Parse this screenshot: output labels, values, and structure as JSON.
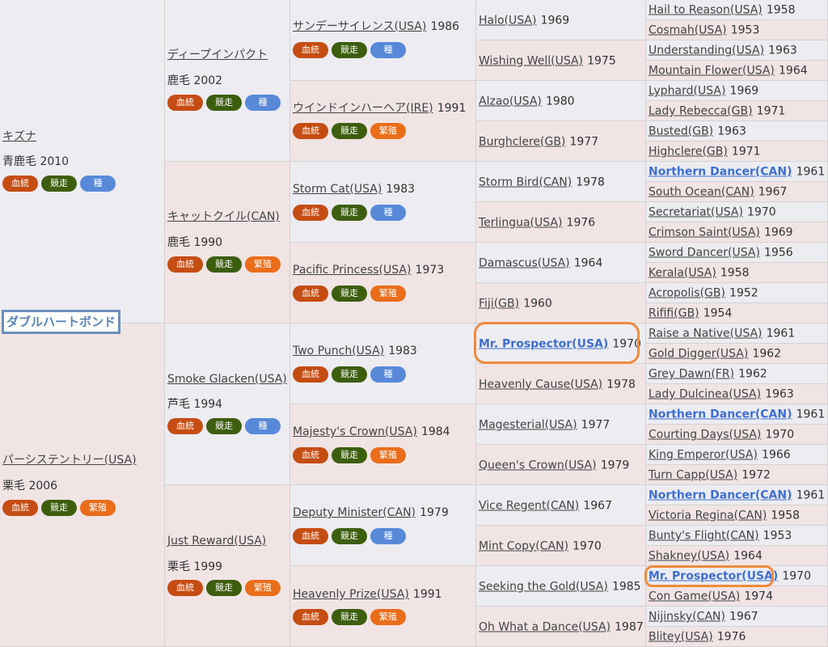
{
  "badges": {
    "ketto": "血統",
    "kyoso": "競走",
    "shu": "種",
    "hanshoku": "繁殖"
  },
  "focus_horse": "ダブルハートボンド",
  "gen1": [
    {
      "name": "キズナ",
      "coat": "青鹿毛 2010",
      "badge3": "種"
    },
    {
      "name": "パーシステントリー(USA)",
      "coat": "栗毛 2006",
      "badge3": "繁殖"
    }
  ],
  "gen2": [
    {
      "name": "ディープインパクト",
      "coat": "鹿毛 2002",
      "badge3": "種"
    },
    {
      "name": "キャットクイル(CAN)",
      "coat": "鹿毛 1990",
      "badge3": "繁殖"
    },
    {
      "name": "Smoke Glacken(USA)",
      "coat": "芦毛 1994",
      "badge3": "種"
    },
    {
      "name": "Just Reward(USA)",
      "coat": "栗毛 1999",
      "badge3": "繁殖"
    }
  ],
  "gen3": [
    {
      "name": "サンデーサイレンス(USA)",
      "year": "1986",
      "badge3": "種"
    },
    {
      "name": "ウインドインハーヘア(IRE)",
      "year": "1991",
      "badge3": "繁殖"
    },
    {
      "name": "Storm Cat(USA)",
      "year": "1983",
      "badge3": "種"
    },
    {
      "name": "Pacific Princess(USA)",
      "year": "1973",
      "badge3": "繁殖"
    },
    {
      "name": "Two Punch(USA)",
      "year": "1983",
      "badge3": "種"
    },
    {
      "name": "Majesty's Crown(USA)",
      "year": "1984",
      "badge3": "繁殖"
    },
    {
      "name": "Deputy Minister(CAN)",
      "year": "1979",
      "badge3": "種"
    },
    {
      "name": "Heavenly Prize(USA)",
      "year": "1991",
      "badge3": "繁殖"
    }
  ],
  "gen4": [
    {
      "name": "Halo(USA)",
      "year": "1969"
    },
    {
      "name": "Wishing Well(USA)",
      "year": "1975"
    },
    {
      "name": "Alzao(USA)",
      "year": "1980"
    },
    {
      "name": "Burghclere(GB)",
      "year": "1977"
    },
    {
      "name": "Storm Bird(CAN)",
      "year": "1978"
    },
    {
      "name": "Terlingua(USA)",
      "year": "1976"
    },
    {
      "name": "Damascus(USA)",
      "year": "1964"
    },
    {
      "name": "Fiji(GB)",
      "year": "1960"
    },
    {
      "name": "Mr. Prospector(USA)",
      "year": "1970"
    },
    {
      "name": "Heavenly Cause(USA)",
      "year": "1978"
    },
    {
      "name": "Magesterial(USA)",
      "year": "1977"
    },
    {
      "name": "Queen's Crown(USA)",
      "year": "1979"
    },
    {
      "name": "Vice Regent(CAN)",
      "year": "1967"
    },
    {
      "name": "Mint Copy(CAN)",
      "year": "1970"
    },
    {
      "name": "Seeking the Gold(USA)",
      "year": "1985"
    },
    {
      "name": "Oh What a Dance(USA)",
      "year": "1987"
    }
  ],
  "gen5": [
    {
      "name": "Hail to Reason(USA)",
      "year": "1958"
    },
    {
      "name": "Cosmah(USA)",
      "year": "1953"
    },
    {
      "name": "Understanding(USA)",
      "year": "1963"
    },
    {
      "name": "Mountain Flower(USA)",
      "year": "1964"
    },
    {
      "name": "Lyphard(USA)",
      "year": "1969"
    },
    {
      "name": "Lady Rebecca(GB)",
      "year": "1971"
    },
    {
      "name": "Busted(GB)",
      "year": "1963"
    },
    {
      "name": "Highclere(GB)",
      "year": "1971"
    },
    {
      "name": "Northern Dancer(CAN)",
      "year": "1961"
    },
    {
      "name": "South Ocean(CAN)",
      "year": "1967"
    },
    {
      "name": "Secretariat(USA)",
      "year": "1970"
    },
    {
      "name": "Crimson Saint(USA)",
      "year": "1969"
    },
    {
      "name": "Sword Dancer(USA)",
      "year": "1956"
    },
    {
      "name": "Kerala(USA)",
      "year": "1958"
    },
    {
      "name": "Acropolis(GB)",
      "year": "1952"
    },
    {
      "name": "Rififi(GB)",
      "year": "1954"
    },
    {
      "name": "Raise a Native(USA)",
      "year": "1961"
    },
    {
      "name": "Gold Digger(USA)",
      "year": "1962"
    },
    {
      "name": "Grey Dawn(FR)",
      "year": "1962"
    },
    {
      "name": "Lady Dulcinea(USA)",
      "year": "1963"
    },
    {
      "name": "Northern Dancer(CAN)",
      "year": "1961"
    },
    {
      "name": "Courting Days(USA)",
      "year": "1970"
    },
    {
      "name": "King Emperor(USA)",
      "year": "1966"
    },
    {
      "name": "Turn Capp(USA)",
      "year": "1972"
    },
    {
      "name": "Northern Dancer(CAN)",
      "year": "1961"
    },
    {
      "name": "Victoria Regina(CAN)",
      "year": "1958"
    },
    {
      "name": "Bunty's Flight(CAN)",
      "year": "1953"
    },
    {
      "name": "Shakney(USA)",
      "year": "1964"
    },
    {
      "name": "Mr. Prospector(USA)",
      "year": "1970"
    },
    {
      "name": "Con Game(USA)",
      "year": "1974"
    },
    {
      "name": "Nijinsky(CAN)",
      "year": "1967"
    },
    {
      "name": "Blitey(USA)",
      "year": "1976"
    }
  ]
}
